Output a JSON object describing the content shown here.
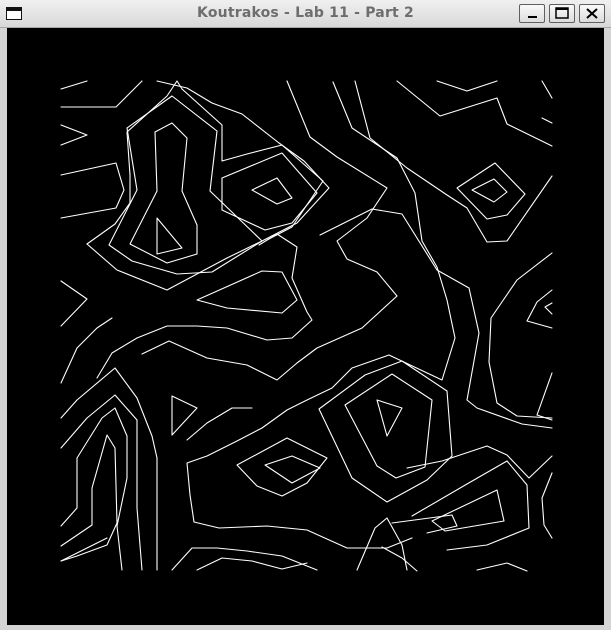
{
  "window": {
    "title": "Koutrakos - Lab 11 - Part 2",
    "controls": [
      "minimize",
      "maximize",
      "close"
    ]
  },
  "plot": {
    "background": "#000000",
    "line_color": "#ffffff",
    "icon_names": [
      "contour-lines"
    ]
  }
}
